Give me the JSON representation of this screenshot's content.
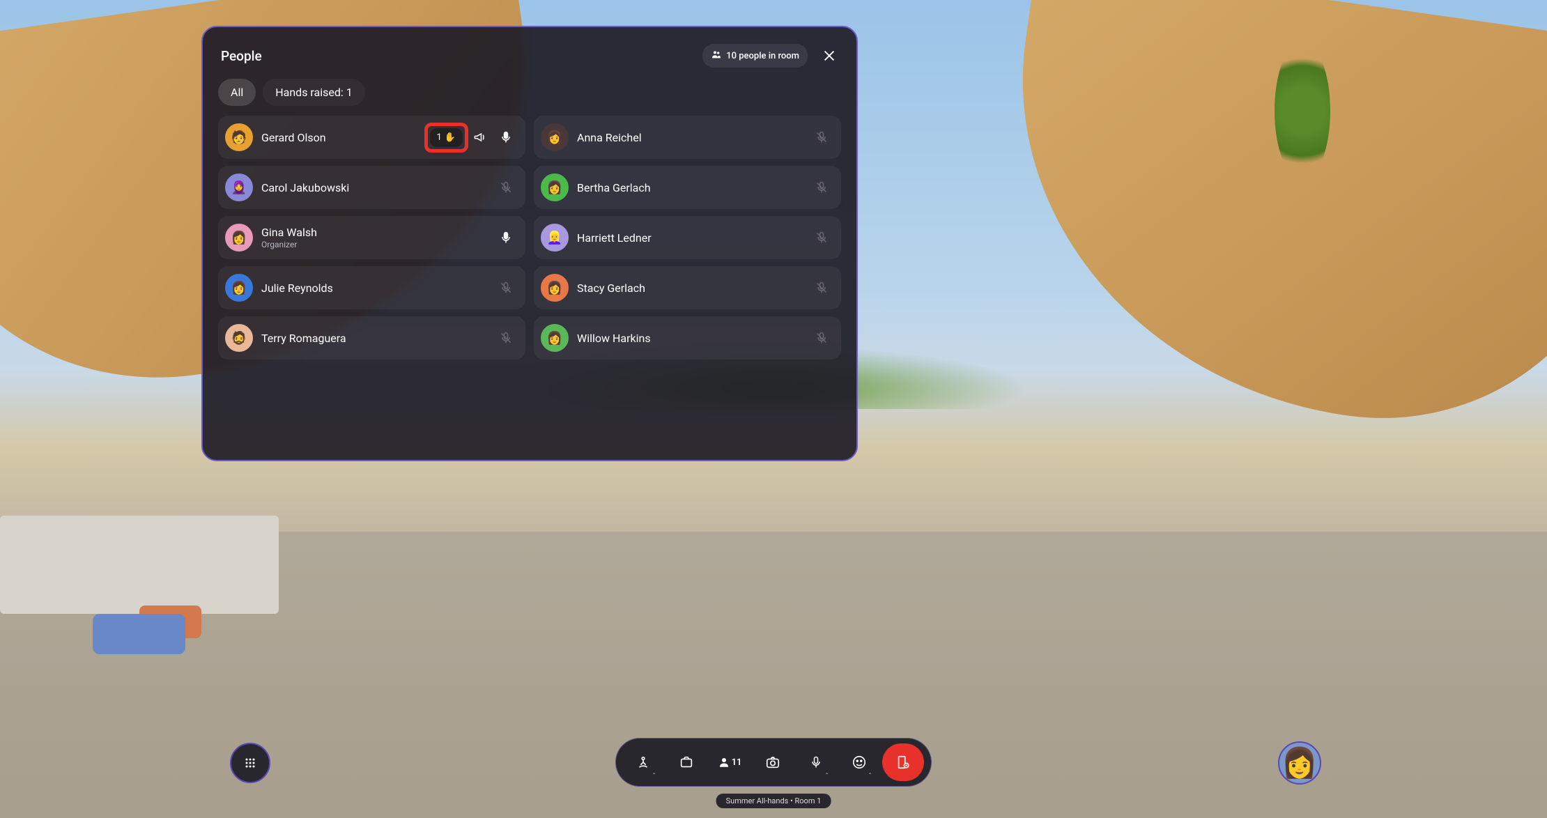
{
  "panel": {
    "title": "People",
    "room_badge": "10 people in room"
  },
  "tabs": {
    "all": "All",
    "hands_raised": "Hands raised: 1"
  },
  "people": [
    {
      "name": "Gerard Olson",
      "role": "",
      "avatar_bg": "#e8a030",
      "initial": "🧑",
      "hand_raised": true,
      "hand_order": "1",
      "megaphone": true,
      "mic": "on"
    },
    {
      "name": "Anna Reichel",
      "role": "",
      "avatar_bg": "#4a3838",
      "initial": "👩",
      "mic": "muted"
    },
    {
      "name": "Carol Jakubowski",
      "role": "",
      "avatar_bg": "#8a88d8",
      "initial": "🧕",
      "mic": "muted"
    },
    {
      "name": "Bertha Gerlach",
      "role": "",
      "avatar_bg": "#4aba4a",
      "initial": "👩",
      "mic": "muted"
    },
    {
      "name": "Gina Walsh",
      "role": "Organizer",
      "avatar_bg": "#e89ab8",
      "initial": "👩",
      "mic": "on"
    },
    {
      "name": "Harriett Ledner",
      "role": "",
      "avatar_bg": "#a898e0",
      "initial": "👱‍♀️",
      "mic": "muted"
    },
    {
      "name": "Julie Reynolds",
      "role": "",
      "avatar_bg": "#3878d8",
      "initial": "👩",
      "mic": "muted"
    },
    {
      "name": "Stacy Gerlach",
      "role": "",
      "avatar_bg": "#e87848",
      "initial": "👩",
      "mic": "muted"
    },
    {
      "name": "Terry Romaguera",
      "role": "",
      "avatar_bg": "#e8b898",
      "initial": "🧔",
      "mic": "muted"
    },
    {
      "name": "Willow Harkins",
      "role": "",
      "avatar_bg": "#5ab858",
      "initial": "👩",
      "mic": "muted"
    }
  ],
  "toolbar": {
    "people_count": "11"
  },
  "footer": {
    "room_label": "Summer All-hands • Room 1"
  }
}
